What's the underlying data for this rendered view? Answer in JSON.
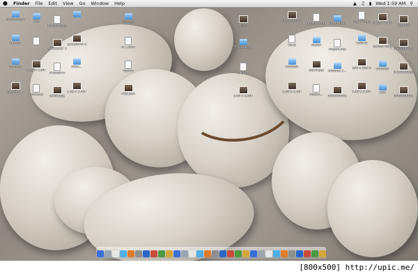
{
  "menubar": {
    "apple": "",
    "items": [
      "Finder",
      "File",
      "Edit",
      "View",
      "Go",
      "Window",
      "Help"
    ],
    "clock": "Wed 1:59 AM"
  },
  "icons": [
    {
      "label": "ubuntu.edu",
      "type": "folder"
    },
    {
      "label": "b2s",
      "type": "folder"
    },
    {
      "label": "Paradise.pp",
      "type": "file"
    },
    {
      "label": "",
      "type": "folder"
    },
    {
      "label": "Untitled",
      "type": "folder"
    },
    {
      "label": "Pics...",
      "type": "image"
    },
    {
      "label": "0.20 x 0.40 m.psd",
      "type": "image"
    },
    {
      "label": "ubuntu-000...pptx",
      "type": "file"
    },
    {
      "label": "Font UPCF",
      "type": "folder"
    },
    {
      "label": "logo SP.eps",
      "type": "file"
    },
    {
      "label": "0.20 x 0.40 m.psd",
      "type": "image"
    },
    {
      "label": "logo SP",
      "type": "image"
    },
    {
      "label": "ไฟล์งาน",
      "type": "folder"
    },
    {
      "label": "",
      "type": "file"
    },
    {
      "label": "AS323237 17.jpg",
      "type": "image"
    },
    {
      "label": "12345676 45.psd",
      "type": "image"
    },
    {
      "label": "m...wmv",
      "type": "file"
    },
    {
      "label": "รวมไฟล์งาน",
      "type": "folder"
    },
    {
      "label": "ปก.ai",
      "type": "file"
    },
    {
      "label": "ifolder",
      "type": "folder"
    },
    {
      "label": "nisport.mp",
      "type": "file"
    },
    {
      "label": "ไฟล์งาน",
      "type": "folder"
    },
    {
      "label": "Kamon kong 2.jpg",
      "type": "image"
    },
    {
      "label": "DSC00646.P PC",
      "type": "image"
    },
    {
      "label": "เรื่องงาน",
      "type": "folder"
    },
    {
      "label": "1.20 x 1.00 m.psd",
      "type": "image"
    },
    {
      "label": "กำหนดการ",
      "type": "file"
    },
    {
      "label": "Alias...",
      "type": "folder"
    },
    {
      "label": "ใบเสร็จ",
      "type": "file"
    },
    {
      "label": "AMPR...",
      "type": "file"
    },
    {
      "label": "Untitled",
      "type": "folder"
    },
    {
      "label": "sip10.jpg",
      "type": "image"
    },
    {
      "label": "Untitled 1...",
      "type": "folder"
    },
    {
      "label": "366 x 200 m.psd",
      "type": "image"
    },
    {
      "label": "Untitled",
      "type": "folder"
    },
    {
      "label": "8-150x60.jpg",
      "type": "image"
    },
    {
      "label": "sa_coke ...",
      "type": "image"
    },
    {
      "label": "torcha12",
      "type": "file"
    },
    {
      "label": "LOGO.jpg",
      "type": "image"
    },
    {
      "label": "1.50 x 1.00 m.psd",
      "type": "image"
    },
    {
      "label": "PSO.psd",
      "type": "image"
    },
    {
      "label": "2.00 x 3.00 m.psd",
      "type": "image"
    },
    {
      "label": "1.00 x 1.50 m.jpg",
      "type": "image"
    },
    {
      "label": "MEDIA...",
      "type": "file"
    },
    {
      "label": "IMAGE0000.jpg",
      "type": "image"
    },
    {
      "label": "3.00 x 2.00 m",
      "type": "image"
    },
    {
      "label": "255",
      "type": "folder"
    },
    {
      "label": "IMAGE0000.jpg",
      "type": "image"
    }
  ],
  "dock": {
    "item_count": 30
  },
  "watermark": "[800x500] http://upic.me/"
}
